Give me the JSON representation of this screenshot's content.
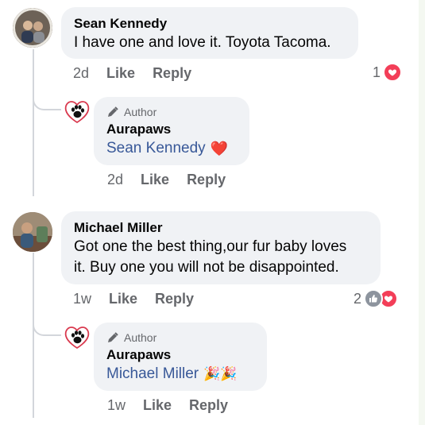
{
  "comments": [
    {
      "author": "Sean Kennedy",
      "text": "I have one and love it. Toyota Tacoma.",
      "time": "2d",
      "like_label": "Like",
      "reply_label": "Reply",
      "reaction_count": "1",
      "reaction_icons": [
        "heart-icon"
      ],
      "reply": {
        "badge": "Author",
        "author": "Aurapaws",
        "mention": "Sean Kennedy",
        "emoji": "❤️",
        "time": "2d",
        "like_label": "Like",
        "reply_label": "Reply"
      }
    },
    {
      "author": "Michael Miller",
      "text_line1": "Got one the best thing,our fur baby loves",
      "text_line2": "it. Buy one you will not be disappointed.",
      "time": "1w",
      "like_label": "Like",
      "reply_label": "Reply",
      "reaction_count": "2",
      "reaction_icons": [
        "thumbs-up-icon",
        "heart-icon"
      ],
      "reply": {
        "badge": "Author",
        "author": "Aurapaws",
        "mention": "Michael Miller",
        "emoji": "🎉🎉",
        "time": "1w",
        "like_label": "Like",
        "reply_label": "Reply"
      }
    }
  ],
  "colors": {
    "bubble": "#f0f2f5",
    "mention": "#385898",
    "love": "#f33e58",
    "like": "#8d949e"
  }
}
